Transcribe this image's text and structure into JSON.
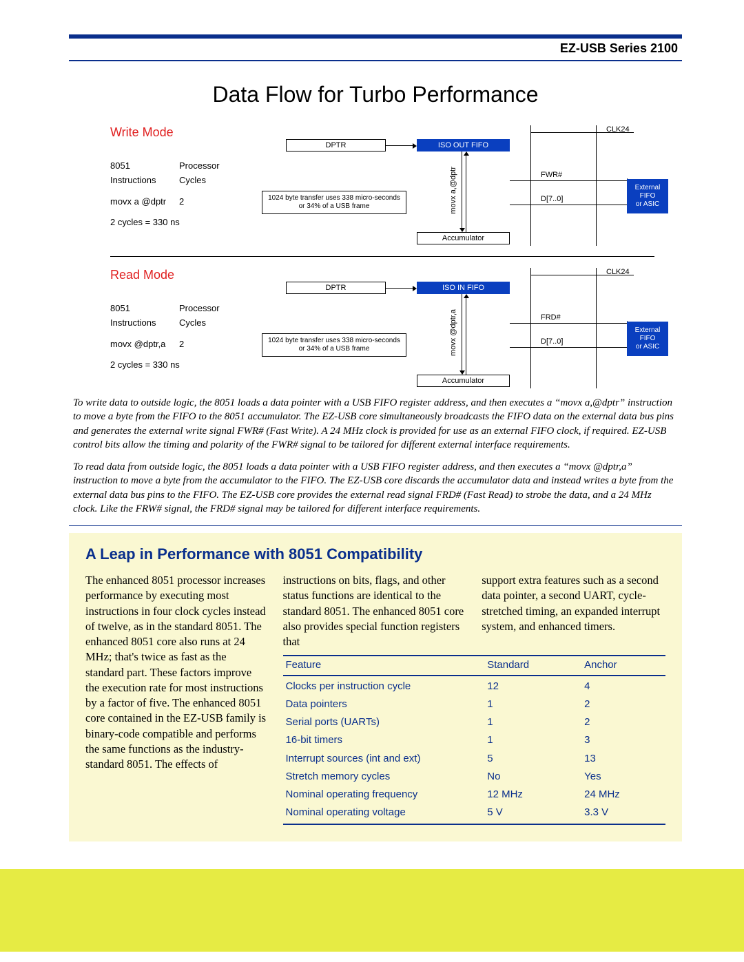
{
  "header": {
    "series": "EZ-USB Series 2100"
  },
  "title": "Data Flow for Turbo Performance",
  "write_mode": {
    "heading": "Write Mode",
    "col1a": "8051",
    "col1b": "Processor",
    "col2a": "Instructions",
    "col2b": "Cycles",
    "instr": "movx a @dptr",
    "cycles": "2",
    "timing": "2 cycles = 330 ns",
    "dptr": "DPTR",
    "iso": "ISO OUT FIFO",
    "note": "1024 byte transfer uses 338 micro-seconds or 34% of a USB frame",
    "acc": "Accumulator",
    "movx": "movx a,@dptr",
    "clk": "CLK24",
    "fwr": "FWR#",
    "d70": "D[7..0]",
    "ext1": "External",
    "ext2": "FIFO",
    "ext3": "or ASIC"
  },
  "read_mode": {
    "heading": "Read Mode",
    "col1a": "8051",
    "col1b": "Processor",
    "col2a": "Instructions",
    "col2b": "Cycles",
    "instr": "movx @dptr,a",
    "cycles": "2",
    "timing": "2 cycles = 330 ns",
    "dptr": "DPTR",
    "iso": "ISO IN FIFO",
    "note": "1024 byte transfer uses 338 micro-seconds or 34% of a USB frame",
    "acc": "Accumulator",
    "movx": "movx @dptr,a",
    "clk": "CLK24",
    "frd": "FRD#",
    "d70": "D[7..0]",
    "ext1": "External",
    "ext2": "FIFO",
    "ext3": "or ASIC"
  },
  "para1": "To write data to outside logic, the 8051 loads a data pointer with a USB FIFO register address, and then executes a “movx a,@dptr” instruction to move a byte from the FIFO to the 8051 accumulator. The EZ-USB core simultaneously broadcasts the FIFO data on the external data bus pins and generates the external write signal FWR# (Fast Write). A 24 MHz clock is provided for use as an external FIFO clock, if required. EZ-USB control bits allow the timing and polarity of the FWR# signal to be tailored for different external interface requirements.",
  "para2": "To read data from outside logic, the 8051 loads a data pointer with a USB FIFO register address, and then executes a “movx @dptr,a” instruction to move a byte from the accumulator to the FIFO. The EZ-USB core discards the accumulator data and instead writes a byte from the external data bus pins to the FIFO. The EZ-USB core provides the external read signal FRD# (Fast Read) to strobe the data, and a 24 MHz clock. Like the FRW# signal, the FRD# signal may be tailored for different interface requirements.",
  "yellow": {
    "heading": "A Leap in Performance with 8051 Compatibility",
    "col1": "The enhanced 8051 processor increases performance by executing most instructions in four clock cycles instead of twelve, as in the standard 8051. The enhanced 8051 core also runs at 24 MHz; that's twice as fast as the standard part. These factors improve the execution rate for most instructions by a factor of five. The enhanced 8051 core contained in the EZ-USB family is binary-code compatible and performs the same functions as the industry-standard 8051. The effects of",
    "col2": "instructions on bits, flags, and other status functions are identical to the standard 8051. The enhanced 8051 core also provides special function registers that",
    "col3": "support extra features such as a second data pointer, a second UART, cycle-stretched timing, an expanded interrupt system, and enhanced timers.",
    "table": {
      "head": {
        "c1": "Feature",
        "c2": "Standard",
        "c3": "Anchor"
      },
      "rows": [
        {
          "c1": "Clocks per instruction cycle",
          "c2": "12",
          "c3": "4"
        },
        {
          "c1": "Data pointers",
          "c2": "1",
          "c3": "2"
        },
        {
          "c1": "Serial ports (UARTs)",
          "c2": "1",
          "c3": "2"
        },
        {
          "c1": "16-bit timers",
          "c2": "1",
          "c3": "3"
        },
        {
          "c1": "Interrupt sources (int and ext)",
          "c2": "5",
          "c3": "13"
        },
        {
          "c1": "Stretch memory cycles",
          "c2": "No",
          "c3": "Yes"
        },
        {
          "c1": "Nominal operating frequency",
          "c2": "12 MHz",
          "c3": "24 MHz"
        },
        {
          "c1": "Nominal operating voltage",
          "c2": "5 V",
          "c3": "3.3 V"
        }
      ]
    }
  }
}
